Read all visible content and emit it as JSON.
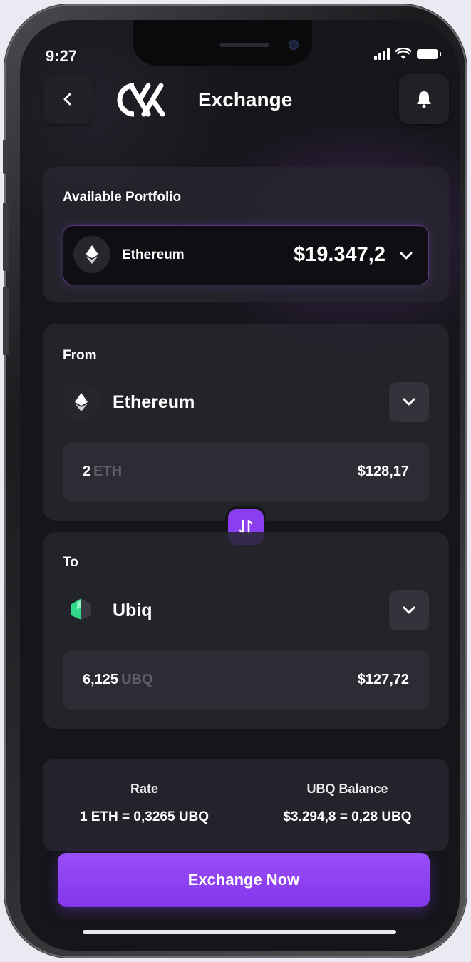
{
  "status_bar": {
    "time": "9:27"
  },
  "header": {
    "title": "Exchange"
  },
  "portfolio": {
    "label": "Available Portfolio",
    "coin": "Ethereum",
    "value": "$19.347,2"
  },
  "from": {
    "label": "From",
    "coin": "Ethereum",
    "amount": "2",
    "unit": "ETH",
    "usd": "$128,17"
  },
  "to": {
    "label": "To",
    "coin": "Ubiq",
    "amount": "6,125",
    "unit": "UBQ",
    "usd": "$127,72"
  },
  "rate": {
    "label": "Rate",
    "value": "1 ETH = 0,3265 UBQ",
    "balance_label": "UBQ Balance",
    "balance_value": "$3.294,8 = 0,28 UBQ"
  },
  "action": {
    "exchange_label": "Exchange Now"
  },
  "colors": {
    "accent": "#8b3ef0",
    "background": "#15151a",
    "ubiq_green": "#2fd88a"
  },
  "icons": [
    "back-arrow-icon",
    "bell-icon",
    "ethereum-icon",
    "ubiq-icon",
    "chevron-down-icon",
    "swap-icon"
  ]
}
